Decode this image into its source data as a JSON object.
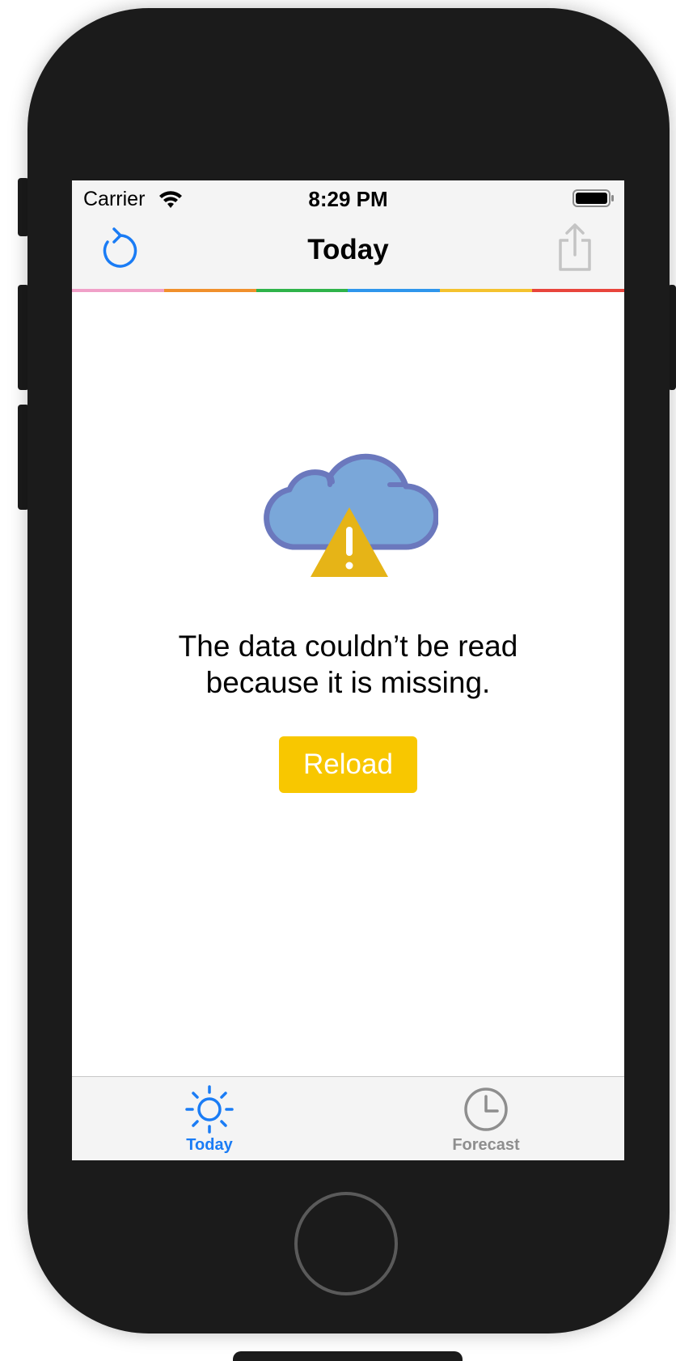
{
  "status_bar": {
    "carrier": "Carrier",
    "time": "8:29 PM",
    "wifi_icon": "wifi-icon",
    "battery_icon": "battery-full-icon"
  },
  "nav_bar": {
    "title": "Today",
    "left_button_icon": "refresh-icon",
    "right_button_icon": "share-icon"
  },
  "accent_stripe_colors": [
    "#f0a0c8",
    "#f0902c",
    "#2fb34a",
    "#2f96ec",
    "#f4c22e",
    "#e8453c"
  ],
  "error_view": {
    "icon": "cloud-warning-icon",
    "message_line1": "The data couldn’t be read",
    "message_line2": "because it is missing.",
    "reload_label": "Reload"
  },
  "tab_bar": {
    "tabs": [
      {
        "label": "Today",
        "icon": "sun-icon",
        "selected": true
      },
      {
        "label": "Forecast",
        "icon": "clock-icon",
        "selected": false
      }
    ]
  },
  "colors": {
    "accent_blue": "#1a7cf5",
    "reload_yellow": "#f8c700",
    "cloud_fill": "#7aa7d9",
    "cloud_stroke": "#6b78bd",
    "warning_yellow": "#e6b417",
    "inactive_gray": "#8e8e8e"
  }
}
